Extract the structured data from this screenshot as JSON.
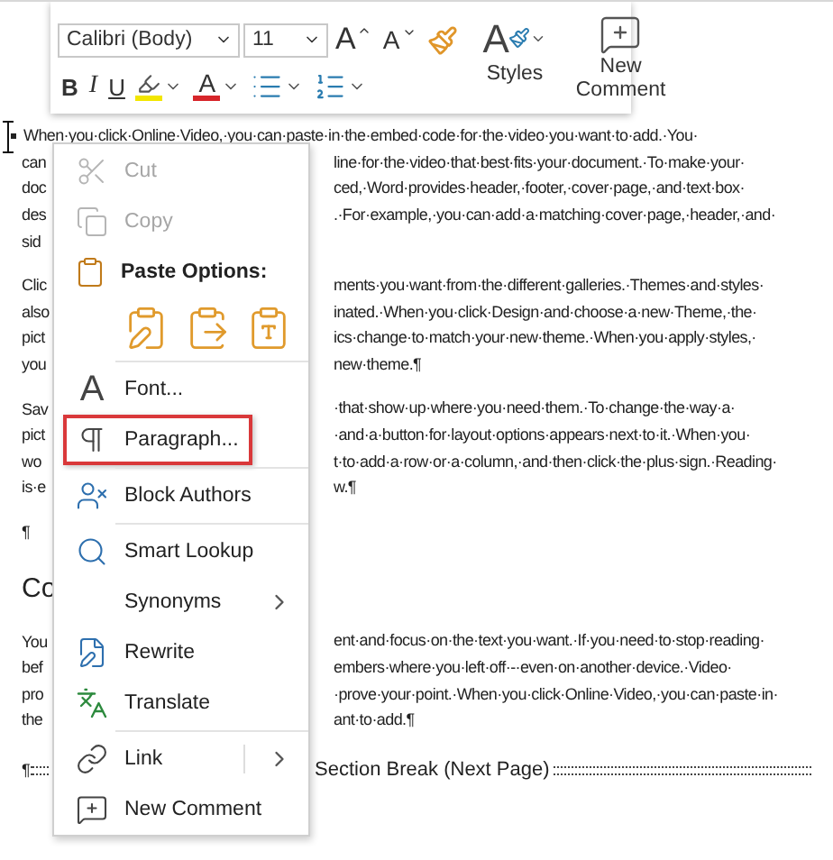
{
  "mini_toolbar": {
    "font": "Calibri (Body)",
    "size": "11",
    "row1": [
      {
        "kind": "grow",
        "label": "A"
      },
      {
        "kind": "shrink",
        "label": "A"
      },
      {
        "kind": "painter"
      }
    ],
    "row2": [
      {
        "kind": "bold",
        "label": "B"
      },
      {
        "kind": "italic",
        "label": "I"
      },
      {
        "kind": "underline",
        "label": "U"
      },
      {
        "kind": "highlight",
        "color": "#f2e600"
      },
      {
        "kind": "font_color",
        "label": "A",
        "color": "#d7262b"
      },
      {
        "kind": "bullets"
      },
      {
        "kind": "numbering"
      }
    ],
    "big_buttons": [
      {
        "kind": "styles",
        "glyph": "A",
        "label": "Styles"
      },
      {
        "kind": "comment",
        "label": "New Comment"
      }
    ]
  },
  "document": {
    "blocks": [
      {
        "kind": "text",
        "lines": [
          {
            "left": "When·you·click·Online·Video,·you·can·paste·in·the·embed·code·for·the·video·you·want·to·add.·You·",
            "bullet": true
          },
          {
            "left": "can",
            "right": "line·for·the·video·that·best·fits·your·document.·To·make·your·"
          },
          {
            "left": "doc",
            "right": "ced,·Word·provides·header,·footer,·cover·page,·and·text·box·"
          },
          {
            "left": "des",
            "right": ".·For·example,·you·can·add·a·matching·cover·page,·header,·and·"
          },
          {
            "left": "sid"
          }
        ]
      },
      {
        "kind": "text",
        "lines": [
          {
            "left": "Clic",
            "right": "ments·you·want·from·the·different·galleries.·Themes·and·styles·"
          },
          {
            "left": "also",
            "right": "inated.·When·you·click·Design·and·choose·a·new·Theme,·the·"
          },
          {
            "left": "pict",
            "right": "ics·change·to·match·your·new·theme.·When·you·apply·styles,·"
          },
          {
            "left": "you",
            "right": "new·theme.¶"
          }
        ]
      },
      {
        "kind": "text",
        "lines": [
          {
            "left": "Sav",
            "right": "·that·show·up·where·you·need·them.·To·change·the·way·a·"
          },
          {
            "left": "pict",
            "right": "·and·a·button·for·layout·options·appears·next·to·it.·When·you·"
          },
          {
            "left": "wo",
            "right": "t·to·add·a·row·or·a·column,·and·then·click·the·plus·sign.·Reading·"
          },
          {
            "left": "is·e",
            "right": "w.¶"
          }
        ]
      },
      {
        "kind": "text",
        "lines": [
          {
            "left": "¶"
          }
        ]
      },
      {
        "kind": "heading",
        "text": "Co"
      },
      {
        "kind": "text",
        "lines": [
          {
            "left": "You",
            "right": "ent·and·focus·on·the·text·you·want.·If·you·need·to·stop·reading·"
          },
          {
            "left": "bef",
            "right": "embers·where·you·left·off·-·even·on·another·device.·Video·"
          },
          {
            "left": "pro",
            "right": "·prove·your·point.·When·you·click·Online·Video,·you·can·paste·in·"
          },
          {
            "left": "the",
            "right": "ant·to·add.¶"
          }
        ]
      },
      {
        "kind": "section_break",
        "mark": "¶",
        "label": "Section Break (Next Page)"
      }
    ]
  },
  "context_menu": {
    "items": [
      {
        "kind": "command",
        "label": "Cut",
        "disabled": true,
        "selected": false
      },
      {
        "kind": "command",
        "label": "Copy",
        "disabled": true,
        "selected": false
      },
      {
        "kind": "header",
        "label": "Paste Options:"
      },
      {
        "kind": "paste_row"
      },
      {
        "kind": "separator"
      },
      {
        "kind": "command",
        "label": "Font...",
        "glyph": "A",
        "disabled": false,
        "selected": false
      },
      {
        "kind": "command",
        "label": "Paragraph...",
        "disabled": false,
        "selected": true
      },
      {
        "kind": "separator"
      },
      {
        "kind": "command",
        "label": "Block Authors",
        "disabled": false,
        "selected": false
      },
      {
        "kind": "separator"
      },
      {
        "kind": "command",
        "label": "Smart Lookup",
        "disabled": false,
        "selected": false
      },
      {
        "kind": "submenu",
        "label": "Synonyms",
        "disabled": false,
        "selected": false
      },
      {
        "kind": "command",
        "label": "Rewrite",
        "disabled": false,
        "selected": false
      },
      {
        "kind": "command",
        "label": "Translate",
        "disabled": false,
        "selected": false
      },
      {
        "kind": "separator"
      },
      {
        "kind": "split_submenu",
        "label": "Link",
        "disabled": false,
        "selected": false
      },
      {
        "kind": "command",
        "label": "New Comment",
        "disabled": false,
        "selected": false
      }
    ]
  }
}
